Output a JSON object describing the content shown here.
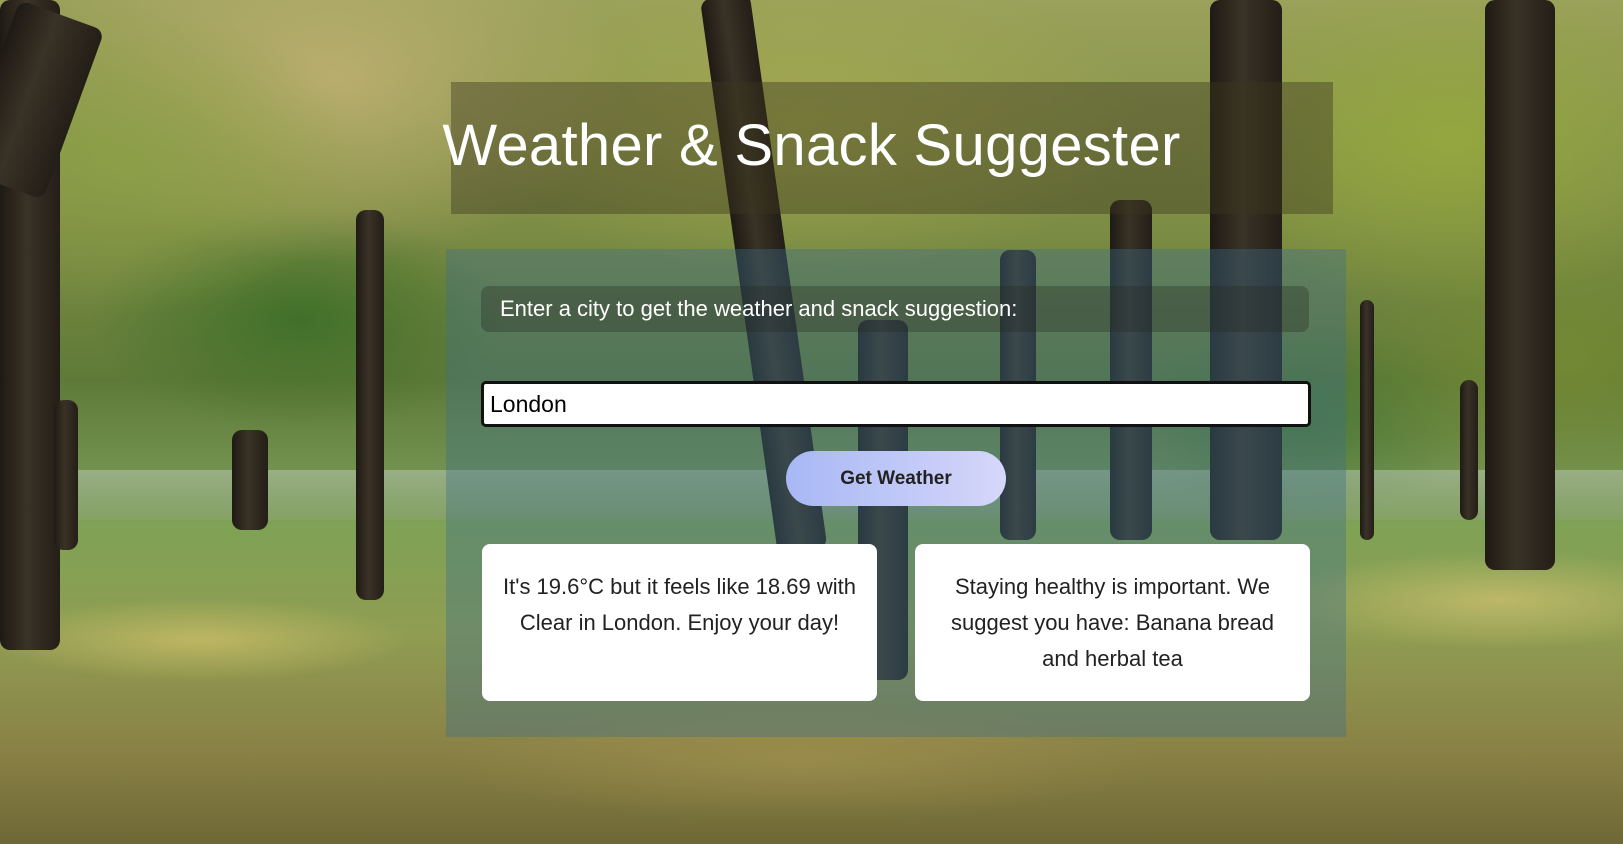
{
  "header": {
    "title": "Weather & Snack Suggester"
  },
  "form": {
    "prompt": "Enter a city to get the weather and snack suggestion:",
    "city_value": "London",
    "button_label": "Get Weather"
  },
  "results": {
    "weather_text": "It's 19.6°C but it feels like 18.69 with Clear in London. Enjoy your day!",
    "snack_text": "Staying healthy is important. We suggest you have: Banana bread and herbal tea"
  },
  "background": {
    "scene": "park-trees-icon"
  }
}
